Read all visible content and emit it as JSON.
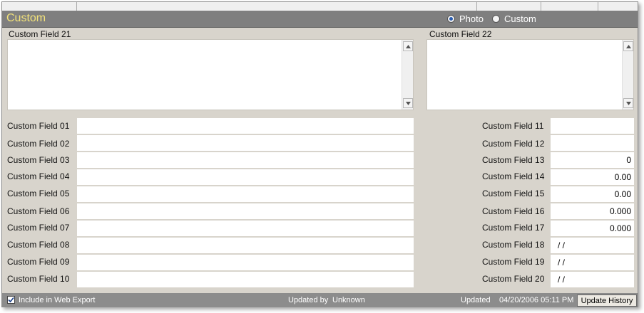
{
  "title": "Custom",
  "view_options": [
    {
      "label": "Photo",
      "selected": true
    },
    {
      "label": "Custom",
      "selected": false
    }
  ],
  "memo_fields": [
    {
      "label": "Custom Field 21",
      "value": ""
    },
    {
      "label": "Custom Field 22",
      "value": ""
    }
  ],
  "left_fields": [
    {
      "label": "Custom Field 01",
      "value": ""
    },
    {
      "label": "Custom Field 02",
      "value": ""
    },
    {
      "label": "Custom Field 03",
      "value": ""
    },
    {
      "label": "Custom Field 04",
      "value": ""
    },
    {
      "label": "Custom Field 05",
      "value": ""
    },
    {
      "label": "Custom Field 06",
      "value": ""
    },
    {
      "label": "Custom Field 07",
      "value": ""
    },
    {
      "label": "Custom Field 08",
      "value": ""
    },
    {
      "label": "Custom Field 09",
      "value": ""
    },
    {
      "label": "Custom Field 10",
      "value": ""
    }
  ],
  "right_fields": [
    {
      "label": "Custom Field 11",
      "value": ""
    },
    {
      "label": "Custom Field 12",
      "value": ""
    },
    {
      "label": "Custom Field 13",
      "value": "0"
    },
    {
      "label": "Custom Field 14",
      "value": "0.00"
    },
    {
      "label": "Custom Field 15",
      "value": "0.00"
    },
    {
      "label": "Custom Field 16",
      "value": "0.000"
    },
    {
      "label": "Custom Field 17",
      "value": "0.000"
    },
    {
      "label": "Custom Field 18",
      "value": "/ /"
    },
    {
      "label": "Custom Field 19",
      "value": "/ /"
    },
    {
      "label": "Custom Field 20",
      "value": "/ /"
    }
  ],
  "footer": {
    "web_export_label": "Include in Web Export",
    "web_export_checked": true,
    "updated_by_label": "Updated by",
    "updated_by_value": "Unknown",
    "updated_label": "Updated",
    "updated_value": "04/20/2006 05:11 PM",
    "update_history_button": "Update History"
  },
  "icons": {
    "scroll_up": "chevron-up-icon",
    "scroll_down": "chevron-down-icon",
    "checkbox": "checkmark-icon"
  },
  "colors": {
    "title_text": "#f2e27a",
    "panel_bg": "#d8d4cc",
    "titlebar_bg": "#7f7f7f",
    "footer_bg": "#8c8c8c"
  }
}
